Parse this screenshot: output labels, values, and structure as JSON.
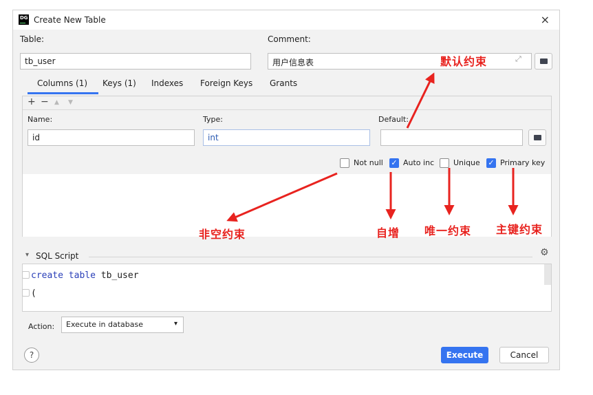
{
  "dialog": {
    "app_icon": "DG",
    "title": "Create New Table",
    "close_glyph": "×"
  },
  "table_field": {
    "label": "Table:",
    "value": "tb_user"
  },
  "comment_field": {
    "label": "Comment:",
    "value": "用户信息表",
    "expand_glyph": "⤢"
  },
  "tabs": [
    {
      "label": "Columns (1)",
      "active": true
    },
    {
      "label": "Keys (1)",
      "active": false
    },
    {
      "label": "Indexes",
      "active": false
    },
    {
      "label": "Foreign Keys",
      "active": false
    },
    {
      "label": "Grants",
      "active": false
    }
  ],
  "toolbar": {
    "add": "+",
    "remove": "−",
    "up": "▲",
    "down": "▼"
  },
  "column_editor": {
    "name_label": "Name:",
    "name_value": "id",
    "type_label": "Type:",
    "type_value": "int",
    "default_label": "Default:",
    "default_value": ""
  },
  "checkboxes": [
    {
      "label": "Not null",
      "checked": false
    },
    {
      "label": "Auto inc",
      "checked": true
    },
    {
      "label": "Unique",
      "checked": false
    },
    {
      "label": "Primary key",
      "checked": true
    }
  ],
  "checkmark": "✓",
  "sql": {
    "section_label": "SQL Script",
    "collapse_glyph": "▾",
    "gear_glyph": "⚙",
    "line1_keyword": "create table",
    "line1_name": " tb_user",
    "line2": "("
  },
  "action": {
    "label": "Action:",
    "value": "Execute in database",
    "arrow": "▾"
  },
  "help_glyph": "?",
  "buttons": {
    "execute": "Execute",
    "cancel": "Cancel"
  },
  "annotations": {
    "default_constraint": "默认约束",
    "not_null_constraint": "非空约束",
    "auto_increment": "自增",
    "unique_constraint": "唯一约束",
    "primary_key_constraint": "主键约束"
  },
  "colors": {
    "accent": "#3574f0",
    "annotation": "#e8231f"
  }
}
